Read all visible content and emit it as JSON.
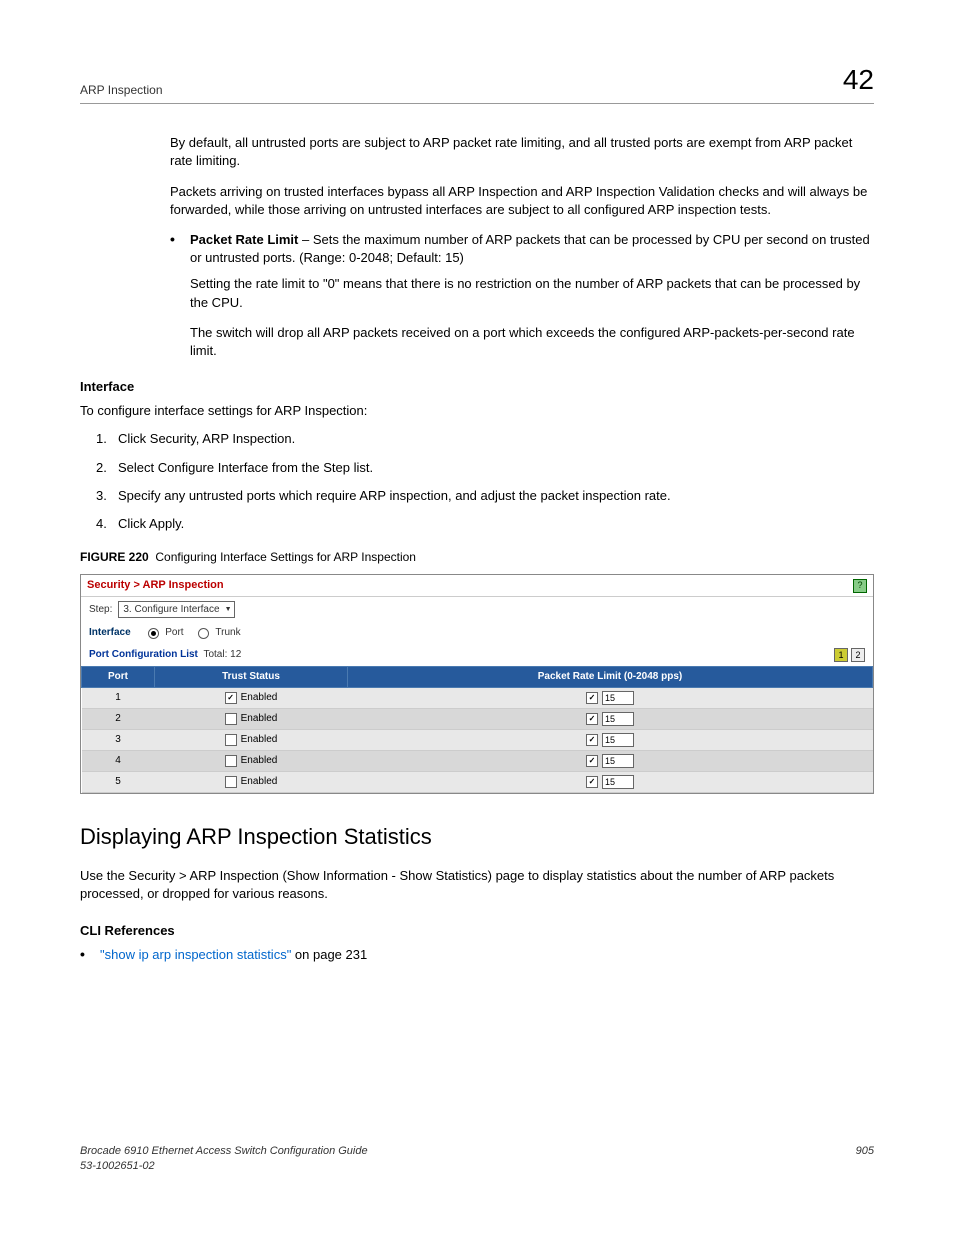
{
  "header": {
    "left": "ARP Inspection",
    "right": "42"
  },
  "p1": "By default, all untrusted ports are subject to ARP packet rate limiting, and all trusted ports are exempt from ARP packet rate limiting.",
  "p2": "Packets arriving on trusted interfaces bypass all ARP Inspection and ARP Inspection Validation checks and will always be forwarded, while those arriving on untrusted interfaces are subject to all configured ARP inspection tests.",
  "bullet1_term": "Packet Rate Limit",
  "bullet1_rest": " – Sets the maximum number of ARP packets that can be processed by CPU per second on trusted or untrusted ports. (Range: 0-2048; Default: 15)",
  "bullet1_p2": "Setting the rate limit to \"0\" means that there is no restriction on the number of ARP packets that can be processed by the CPU.",
  "bullet1_p3": "The switch will drop all ARP packets received on a port which exceeds the configured ARP-packets-per-second rate limit.",
  "interface_heading": "Interface",
  "interface_intro": "To configure interface settings for ARP Inspection:",
  "steps": [
    "Click Security, ARP Inspection.",
    "Select Configure Interface from the Step list.",
    "Specify any untrusted ports which require ARP inspection, and adjust the packet inspection rate.",
    "Click Apply."
  ],
  "figure": {
    "label": "FIGURE 220",
    "caption": "Configuring Interface Settings for ARP Inspection"
  },
  "screenshot": {
    "breadcrumb": "Security > ARP Inspection",
    "step_label": "Step:",
    "step_value": "3. Configure Interface",
    "interface_label": "Interface",
    "radio_port": "Port",
    "radio_trunk": "Trunk",
    "list_title": "Port Configuration List",
    "list_total_label": "Total: ",
    "list_total": "12",
    "pages": [
      "1",
      "2"
    ],
    "columns": [
      "Port",
      "Trust Status",
      "Packet Rate Limit (0-2048 pps)"
    ],
    "rows": [
      {
        "port": "1",
        "trust": true,
        "enabled_label": "Enabled",
        "rate_checked": true,
        "rate": "15"
      },
      {
        "port": "2",
        "trust": false,
        "enabled_label": "Enabled",
        "rate_checked": true,
        "rate": "15"
      },
      {
        "port": "3",
        "trust": false,
        "enabled_label": "Enabled",
        "rate_checked": true,
        "rate": "15"
      },
      {
        "port": "4",
        "trust": false,
        "enabled_label": "Enabled",
        "rate_checked": true,
        "rate": "15"
      },
      {
        "port": "5",
        "trust": false,
        "enabled_label": "Enabled",
        "rate_checked": true,
        "rate": "15"
      }
    ]
  },
  "h2": "Displaying ARP Inspection Statistics",
  "h2_p": "Use the Security > ARP Inspection (Show Information - Show Statistics) page to display statistics about the number of ARP packets processed, or dropped for various reasons.",
  "cli_heading": "CLI References",
  "cli_link": "\"show ip arp inspection statistics\"",
  "cli_rest": " on page 231",
  "footer": {
    "line1": "Brocade 6910 Ethernet Access Switch Configuration Guide",
    "line2": "53-1002651-02",
    "page": "905"
  }
}
